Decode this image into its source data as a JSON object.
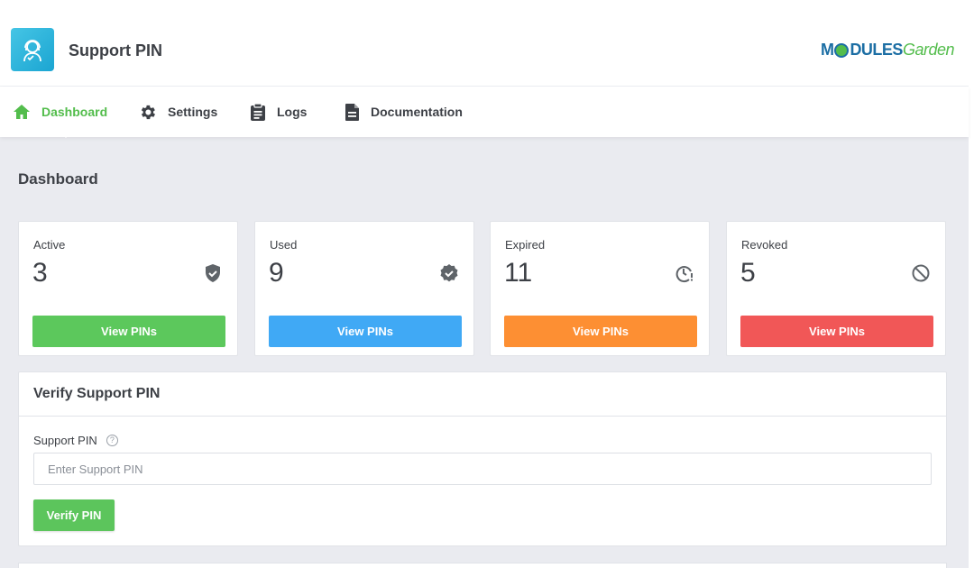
{
  "app": {
    "title": "Support PIN",
    "brand_primary": "M",
    "brand_mid": "DULES",
    "brand_secondary": "Garden",
    "accent": "#53bd4c"
  },
  "nav": {
    "items": [
      {
        "label": "Dashboard",
        "icon": "home-icon",
        "active": true
      },
      {
        "label": "Settings",
        "icon": "gear-icon",
        "active": false
      },
      {
        "label": "Logs",
        "icon": "clipboard-icon",
        "active": false
      },
      {
        "label": "Documentation",
        "icon": "document-icon",
        "active": false
      }
    ]
  },
  "page": {
    "title": "Dashboard"
  },
  "stats": [
    {
      "label": "Active",
      "value": "3",
      "icon": "shield-check-icon",
      "button": "View PINs",
      "color": "#5cc85c"
    },
    {
      "label": "Used",
      "value": "9",
      "icon": "verified-badge-icon",
      "button": "View PINs",
      "color": "#40a9f5"
    },
    {
      "label": "Expired",
      "value": "11",
      "icon": "clock-alert-icon",
      "button": "View PINs",
      "color": "#fd8f33"
    },
    {
      "label": "Revoked",
      "value": "5",
      "icon": "block-icon",
      "button": "View PINs",
      "color": "#f15757"
    }
  ],
  "verify": {
    "title": "Verify Support PIN",
    "field_label": "Support PIN",
    "help": "?",
    "placeholder": "Enter Support PIN",
    "value": "",
    "button": "Verify PIN"
  }
}
